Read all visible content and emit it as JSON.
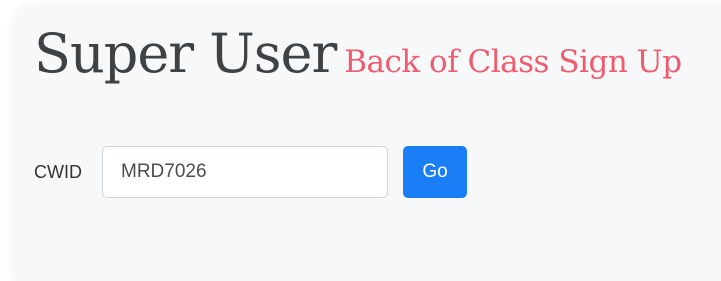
{
  "header": {
    "title": "Super User",
    "subtitle": "Back of Class Sign Up"
  },
  "form": {
    "cwid_label": "CWID",
    "cwid_value": "MRD7026",
    "go_label": "Go"
  }
}
